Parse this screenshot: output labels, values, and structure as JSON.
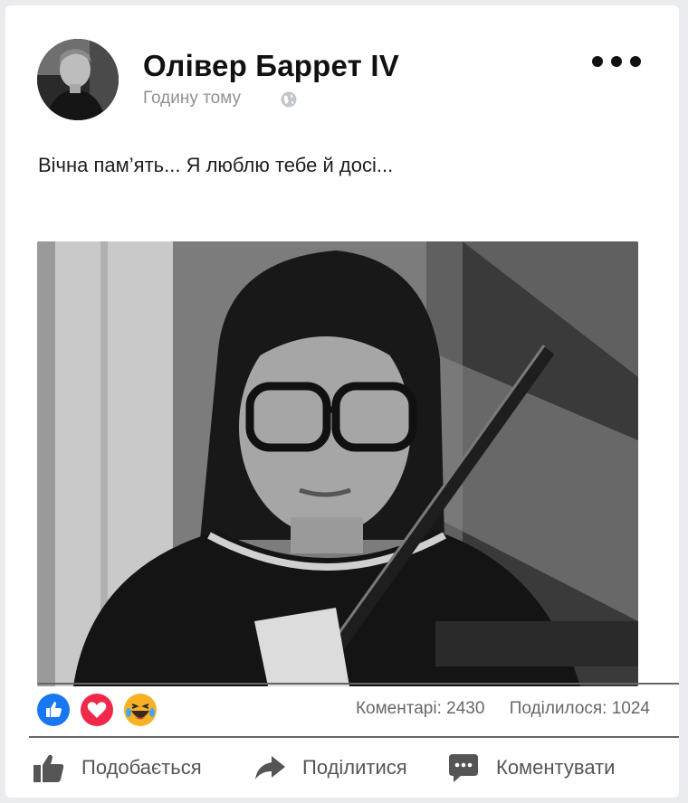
{
  "post": {
    "author_name": "Олівер Баррет IV",
    "timestamp": "Годину тому",
    "privacy_icon": "globe-icon",
    "text": "Вічна пам’ять... Я люблю тебе й досі..."
  },
  "reactions": {
    "icons": [
      "like-reaction-icon",
      "love-reaction-icon",
      "haha-reaction-icon"
    ],
    "colors": {
      "like": "#1877f2",
      "love": "#f02849",
      "haha": "#f7b125"
    },
    "comments_label": "Коментарі: 2430",
    "shares_label": "Поділилося: 1024"
  },
  "actions": {
    "like_label": "Подобається",
    "share_label": "Поділитися",
    "comment_label": "Коментувати"
  }
}
